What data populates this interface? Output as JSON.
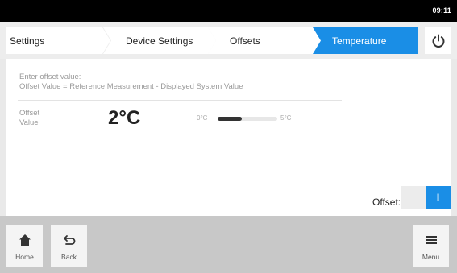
{
  "status": {
    "time": "09:11"
  },
  "breadcrumb": {
    "items": [
      {
        "label": "Settings"
      },
      {
        "label": "Device Settings"
      },
      {
        "label": "Offsets"
      },
      {
        "label": "Temperature"
      }
    ]
  },
  "panel": {
    "instruction_line1": "Enter offset value:",
    "instruction_line2": "Offset Value = Reference Measurement - Displayed System Value",
    "field_label_line1": "Offset",
    "field_label_line2": "Value",
    "value": "2°C",
    "range_min": "0°C",
    "range_max": "5°C",
    "slider_fraction": 0.4,
    "offset_label": "Offset:",
    "toggle_on_label": "I"
  },
  "bottom": {
    "home_label": "Home",
    "back_label": "Back",
    "menu_label": "Menu"
  },
  "colors": {
    "accent": "#1a8ee6",
    "status_bar": "#000000"
  },
  "icons": {
    "power": "power-icon",
    "home": "home-icon",
    "back": "back-arrow-icon",
    "menu": "hamburger-icon"
  }
}
